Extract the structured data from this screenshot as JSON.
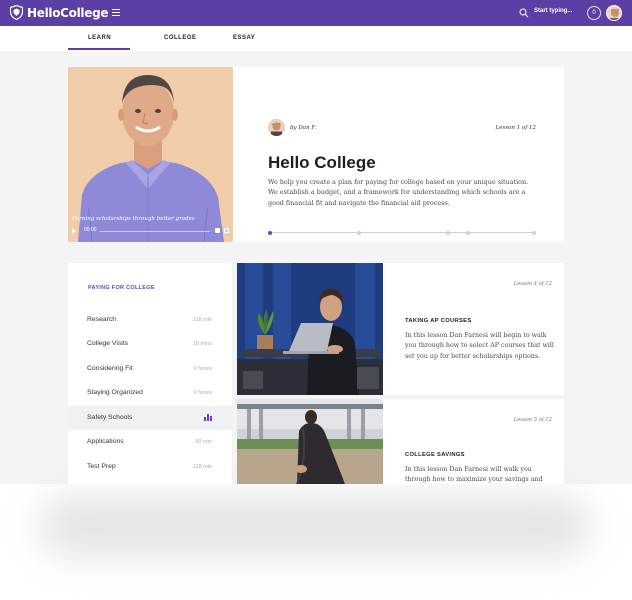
{
  "brand": {
    "name": "HelloCollege",
    "accent": "#5b3fa5",
    "highlight": "#6b3fd1"
  },
  "header": {
    "search_placeholder": "Start typing...",
    "notification_count": "0"
  },
  "tabs": [
    {
      "label": "LEARN",
      "active": true
    },
    {
      "label": "COLLEGE",
      "active": false
    },
    {
      "label": "ESSAY",
      "active": false
    }
  ],
  "hero": {
    "video_caption": "Earning scholarships through better grades",
    "video_time": "00:00",
    "author": "by Dan F.",
    "lesson_count": "Lesson 1 of 12",
    "title": "Hello College",
    "description": "We help you create a plan for paying for college based on your unique situation. We establish a budget, and a framework for understanding which schools are a good financial fit and navigate the financial aid process.",
    "progress_steps": 5,
    "progress_current": 1
  },
  "sidebar": {
    "heading": "PAYING FOR COLLEGE",
    "items": [
      {
        "label": "Research",
        "time": "118 min"
      },
      {
        "label": "College Visits",
        "time": "16 mins"
      },
      {
        "label": "Considering Fit",
        "time": "2 hours"
      },
      {
        "label": "Staying Organized",
        "time": "2 hours"
      },
      {
        "label": "Safety Schools",
        "time": "",
        "active": true,
        "icon": "bar-chart-icon"
      },
      {
        "label": "Applications",
        "time": "93 min"
      },
      {
        "label": "Test Prep",
        "time": "118 min"
      }
    ]
  },
  "lessons": [
    {
      "count": "Lesson 4 of 12",
      "title": "TAKING AP COURSES",
      "description": "In this lesson Dan Farnesi will begin to walk you through how to select AP courses that will set you up for better scholarships options."
    },
    {
      "count": "Lesson 5 of 12",
      "title": "COLLEGE SAVINGS",
      "description": "In this lesson Dan Farnesi will walk you through how to maximize your savings and"
    }
  ]
}
